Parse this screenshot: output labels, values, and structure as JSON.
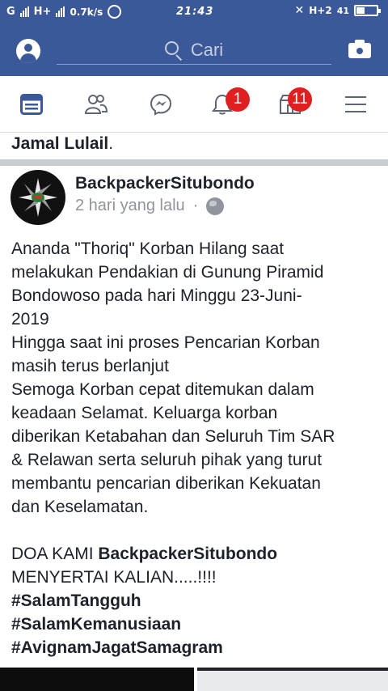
{
  "status_bar": {
    "network_left": "G",
    "network_hplus": "H+",
    "data_speed": "0.7k/s",
    "time": "21:43",
    "network_right": "H+2",
    "battery_percent": "41",
    "signal_bars_filled": 4
  },
  "search": {
    "placeholder": "Cari"
  },
  "nav": {
    "notifications_badge": "1",
    "marketplace_badge": "11"
  },
  "previous_post_tail": {
    "text": "Jamal Lulail",
    "suffix": "."
  },
  "post": {
    "author": "BackpackerSitubondo",
    "time": "2 hari yang lalu",
    "separator": "·",
    "privacy_icon": "globe-icon",
    "lines": [
      "Ananda \"Thoriq\" Korban Hilang saat",
      "melakukan Pendakian di Gunung Piramid",
      "Bondowoso pada hari Minggu 23-Juni-",
      "2019",
      "Hingga saat ini proses Pencarian Korban",
      "masih terus berlanjut",
      "Semoga Korban cepat ditemukan dalam",
      "keadaan Selamat. Keluarga korban",
      "diberikan Ketabahan dan Seluruh Tim SAR",
      "& Relawan serta seluruh pihak yang turut",
      "membantu pencarian diberikan Kekuatan",
      "dan Keselamatan."
    ],
    "doa_prefix": "DOA KAMI ",
    "doa_name": "BackpackerSitubondo",
    "doa_line2": "MENYERTAI KALIAN.....!!!!",
    "hashtags": [
      "#SalamTangguh",
      "#SalamKemanusiaan",
      "#AvignamJagatSamagram"
    ]
  },
  "colors": {
    "brand": "#3b5998",
    "badge": "#e02020",
    "meta_text": "#90949c"
  }
}
